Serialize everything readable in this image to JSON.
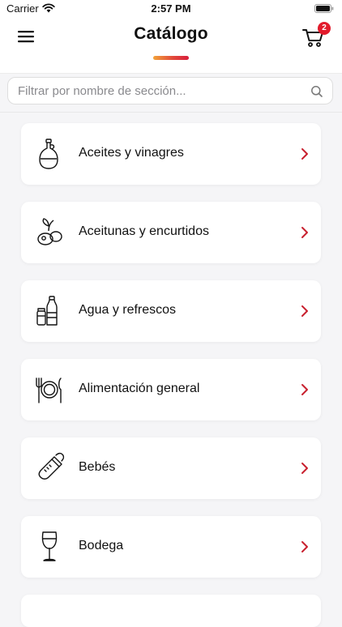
{
  "status_bar": {
    "carrier": "Carrier",
    "time": "2:57 PM",
    "icons": [
      "wifi-icon",
      "battery-icon"
    ]
  },
  "header": {
    "title": "Catálogo",
    "menu_icon": "hamburger-menu-icon",
    "cart_icon": "shopping-cart-icon",
    "cart_count": "2",
    "accent_gradient": [
      "#f2a33a",
      "#e24a3b",
      "#d81e3c"
    ],
    "badge_color": "#e21b2c"
  },
  "search": {
    "placeholder": "Filtrar por nombre de sección...",
    "value": "",
    "icon": "search-icon"
  },
  "sections": [
    {
      "label": "Aceites y vinagres",
      "icon": "oil-bottle-icon"
    },
    {
      "label": "Aceitunas y encurtidos",
      "icon": "olives-icon"
    },
    {
      "label": "Agua y refrescos",
      "icon": "water-bottle-icon"
    },
    {
      "label": "Alimentación general",
      "icon": "plate-cutlery-icon"
    },
    {
      "label": "Bebés",
      "icon": "baby-bottle-icon"
    },
    {
      "label": "Bodega",
      "icon": "wine-glass-icon"
    }
  ],
  "chevron_color": "#c8202f"
}
